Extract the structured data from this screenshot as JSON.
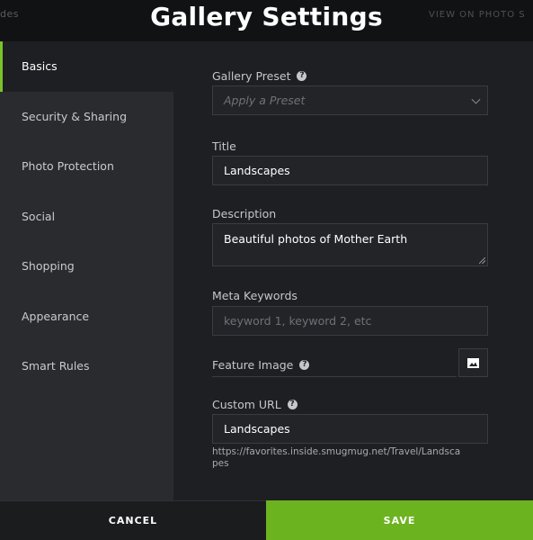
{
  "background": {
    "left_text": "des",
    "right_text": "VIEW ON PHOTO S"
  },
  "modal": {
    "title": "Gallery Settings"
  },
  "sidebar": {
    "items": [
      {
        "label": "Basics",
        "active": true
      },
      {
        "label": "Security & Sharing",
        "active": false
      },
      {
        "label": "Photo Protection",
        "active": false
      },
      {
        "label": "Social",
        "active": false
      },
      {
        "label": "Shopping",
        "active": false
      },
      {
        "label": "Appearance",
        "active": false
      },
      {
        "label": "Smart Rules",
        "active": false
      }
    ]
  },
  "form": {
    "preset": {
      "label": "Gallery Preset",
      "placeholder": "Apply a Preset"
    },
    "title": {
      "label": "Title",
      "value": "Landscapes"
    },
    "description": {
      "label": "Description",
      "value": "Beautiful photos of Mother Earth"
    },
    "keywords": {
      "label": "Meta Keywords",
      "placeholder": "keyword 1, keyword 2, etc"
    },
    "feature_image": {
      "label": "Feature Image"
    },
    "custom_url": {
      "label": "Custom URL",
      "value": "Landscapes",
      "hint": "https://favorites.inside.smugmug.net/Travel/Landscapes"
    }
  },
  "footer": {
    "cancel_label": "CANCEL",
    "save_label": "SAVE"
  },
  "colors": {
    "accent": "#6cb320",
    "panel": "#1e1f22",
    "sidebar": "#2a2b2f"
  },
  "icons": {
    "help": "help-circle-icon",
    "image": "image-icon",
    "chevron": "chevron-down-icon"
  }
}
